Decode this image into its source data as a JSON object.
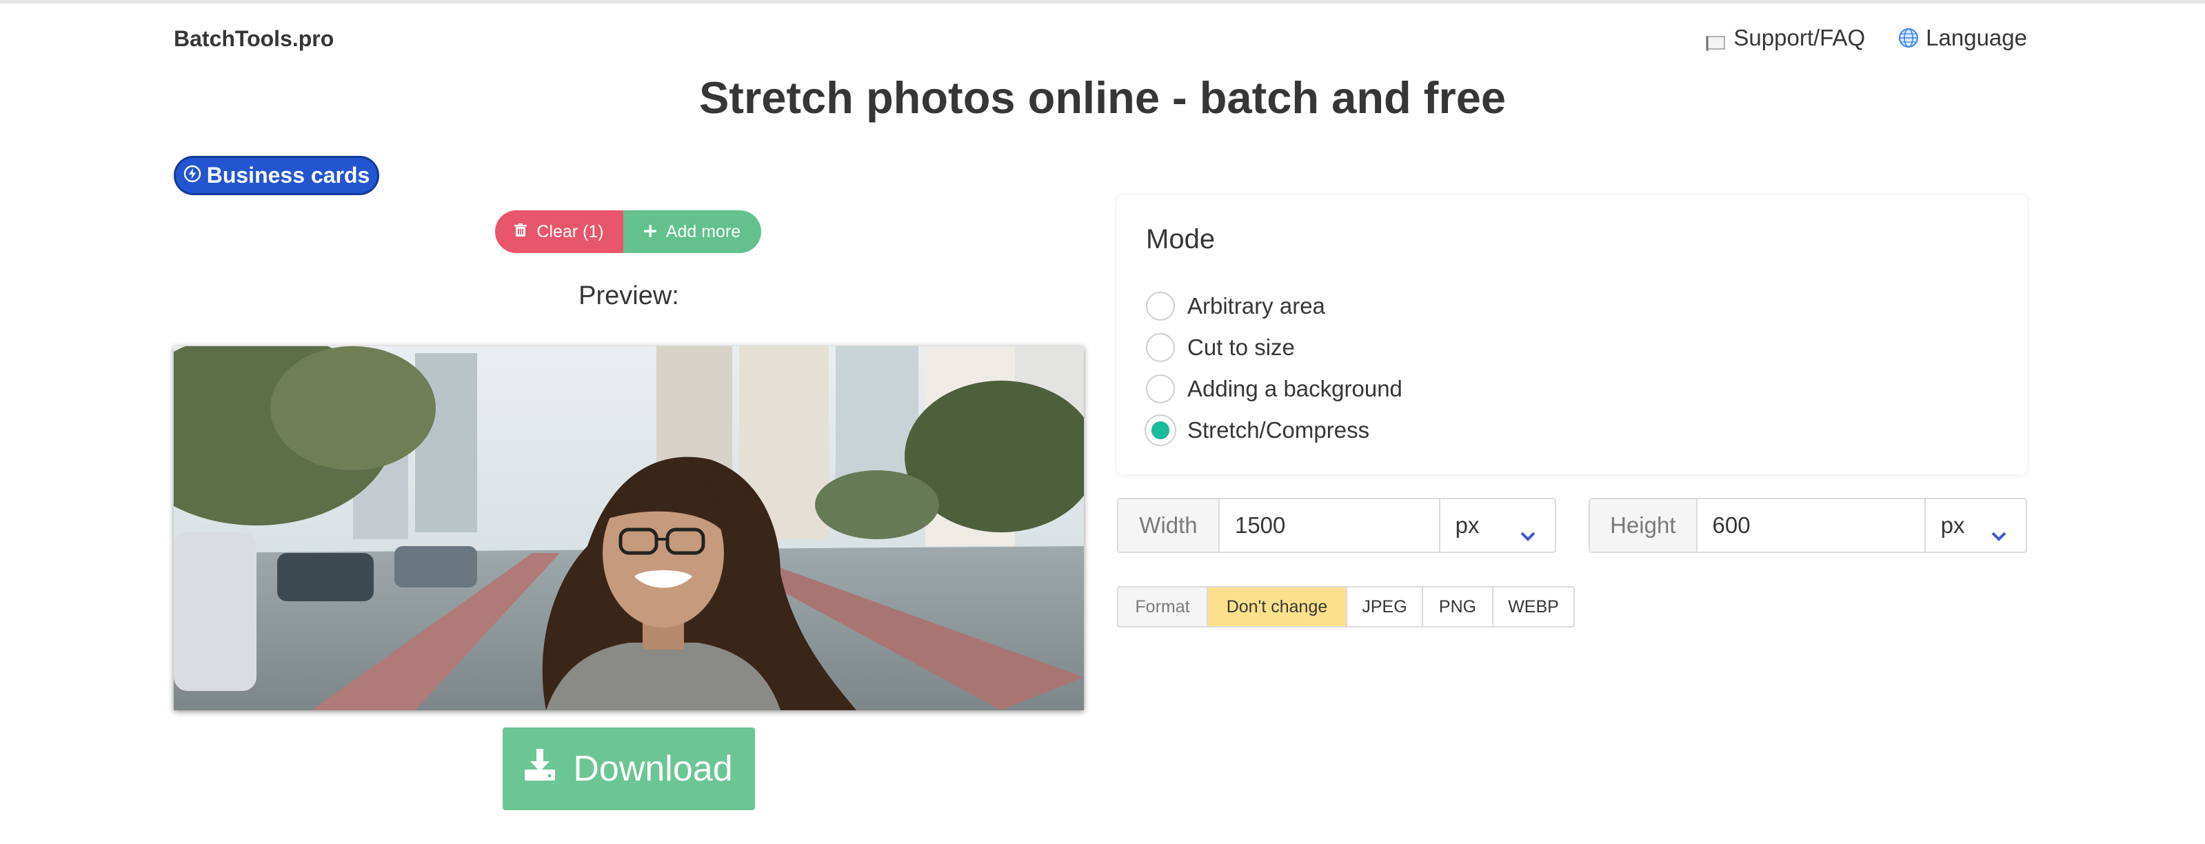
{
  "header": {
    "brand": "BatchTools.pro",
    "nav": [
      {
        "label": "Support/FAQ",
        "icon": "flag-icon"
      },
      {
        "label": "Language",
        "icon": "globe-icon"
      }
    ]
  },
  "page_title": "Stretch photos online - batch and free",
  "business_cards_label": "Business cards",
  "file_buttons": {
    "clear_label": "Clear (1)",
    "add_label": "Add more"
  },
  "preview_label": "Preview:",
  "download_label": "Download",
  "mode": {
    "title": "Mode",
    "options": [
      {
        "label": "Arbitrary area",
        "checked": false
      },
      {
        "label": "Cut to size",
        "checked": false
      },
      {
        "label": "Adding a background",
        "checked": false
      },
      {
        "label": "Stretch/Compress",
        "checked": true
      }
    ]
  },
  "dimensions": {
    "width": {
      "label": "Width",
      "value": "1500",
      "unit": "px"
    },
    "height": {
      "label": "Height",
      "value": "600",
      "unit": "px"
    }
  },
  "format": {
    "label": "Format",
    "options": [
      "Don't change",
      "JPEG",
      "PNG",
      "WEBP"
    ],
    "selected": "Don't change"
  },
  "colors": {
    "accent_blue": "#2355d0",
    "clear_red": "#e8566b",
    "add_green": "#62c18d",
    "download_green": "#6cc594",
    "radio_teal": "#1abc9c",
    "format_selected": "#fde08b"
  }
}
